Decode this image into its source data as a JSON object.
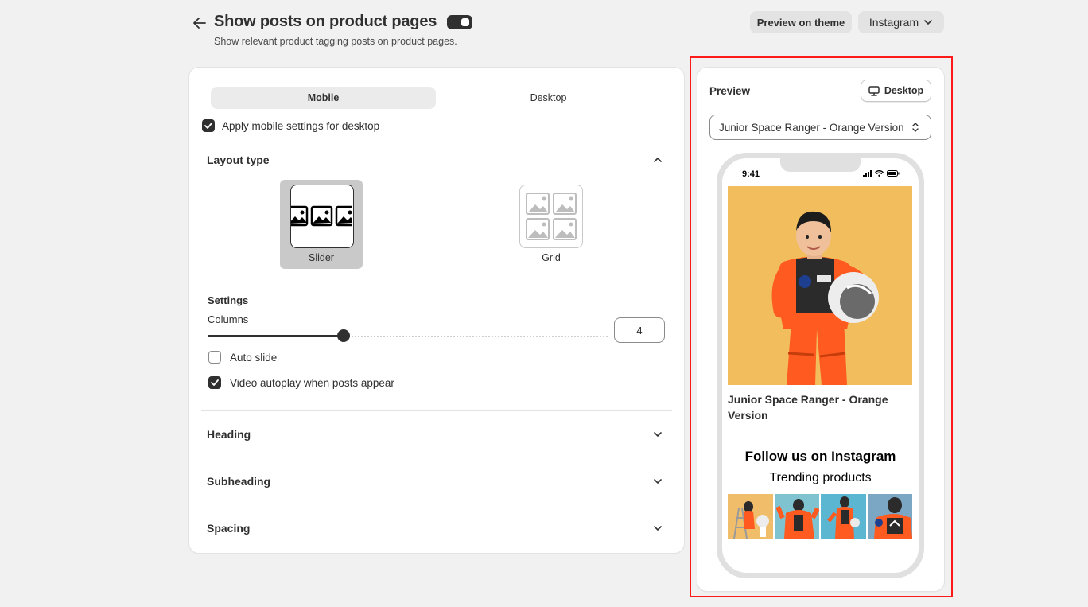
{
  "header": {
    "title": "Show posts on product pages",
    "subtitle": "Show relevant product tagging posts on product pages.",
    "preview_on_theme": "Preview on theme",
    "channel_select": "Instagram",
    "enabled": true
  },
  "settings_card": {
    "tabs": [
      {
        "label": "Mobile",
        "active": true
      },
      {
        "label": "Desktop",
        "active": false
      }
    ],
    "apply_mobile_label": "Apply mobile settings for desktop",
    "apply_mobile_checked": true,
    "layout_type": {
      "title": "Layout type",
      "options": [
        {
          "label": "Slider",
          "selected": true
        },
        {
          "label": "Grid",
          "selected": false
        }
      ]
    },
    "settings": {
      "title": "Settings",
      "columns_label": "Columns",
      "columns_value": "4",
      "columns_slider_fraction": 0.34,
      "auto_slide_label": "Auto slide",
      "auto_slide_checked": false,
      "video_autoplay_label": "Video autoplay when posts appear",
      "video_autoplay_checked": true
    },
    "sections": [
      {
        "title": "Heading"
      },
      {
        "title": "Subheading"
      },
      {
        "title": "Spacing"
      }
    ]
  },
  "preview": {
    "title": "Preview",
    "device_button": "Desktop",
    "product_select": "Junior Space Ranger - Orange Version",
    "phone": {
      "time": "9:41",
      "product_title": "Junior Space Ranger - Orange Version",
      "follow_heading": "Follow us on Instagram",
      "trending": "Trending products",
      "thumb_count": 4
    }
  },
  "colors": {
    "page_bg": "#f1f1f1",
    "dark": "#303030",
    "highlight_border": "#ff1a1a",
    "hero_bg": "#f2bd5c",
    "suit_orange": "#ff5a1f"
  }
}
